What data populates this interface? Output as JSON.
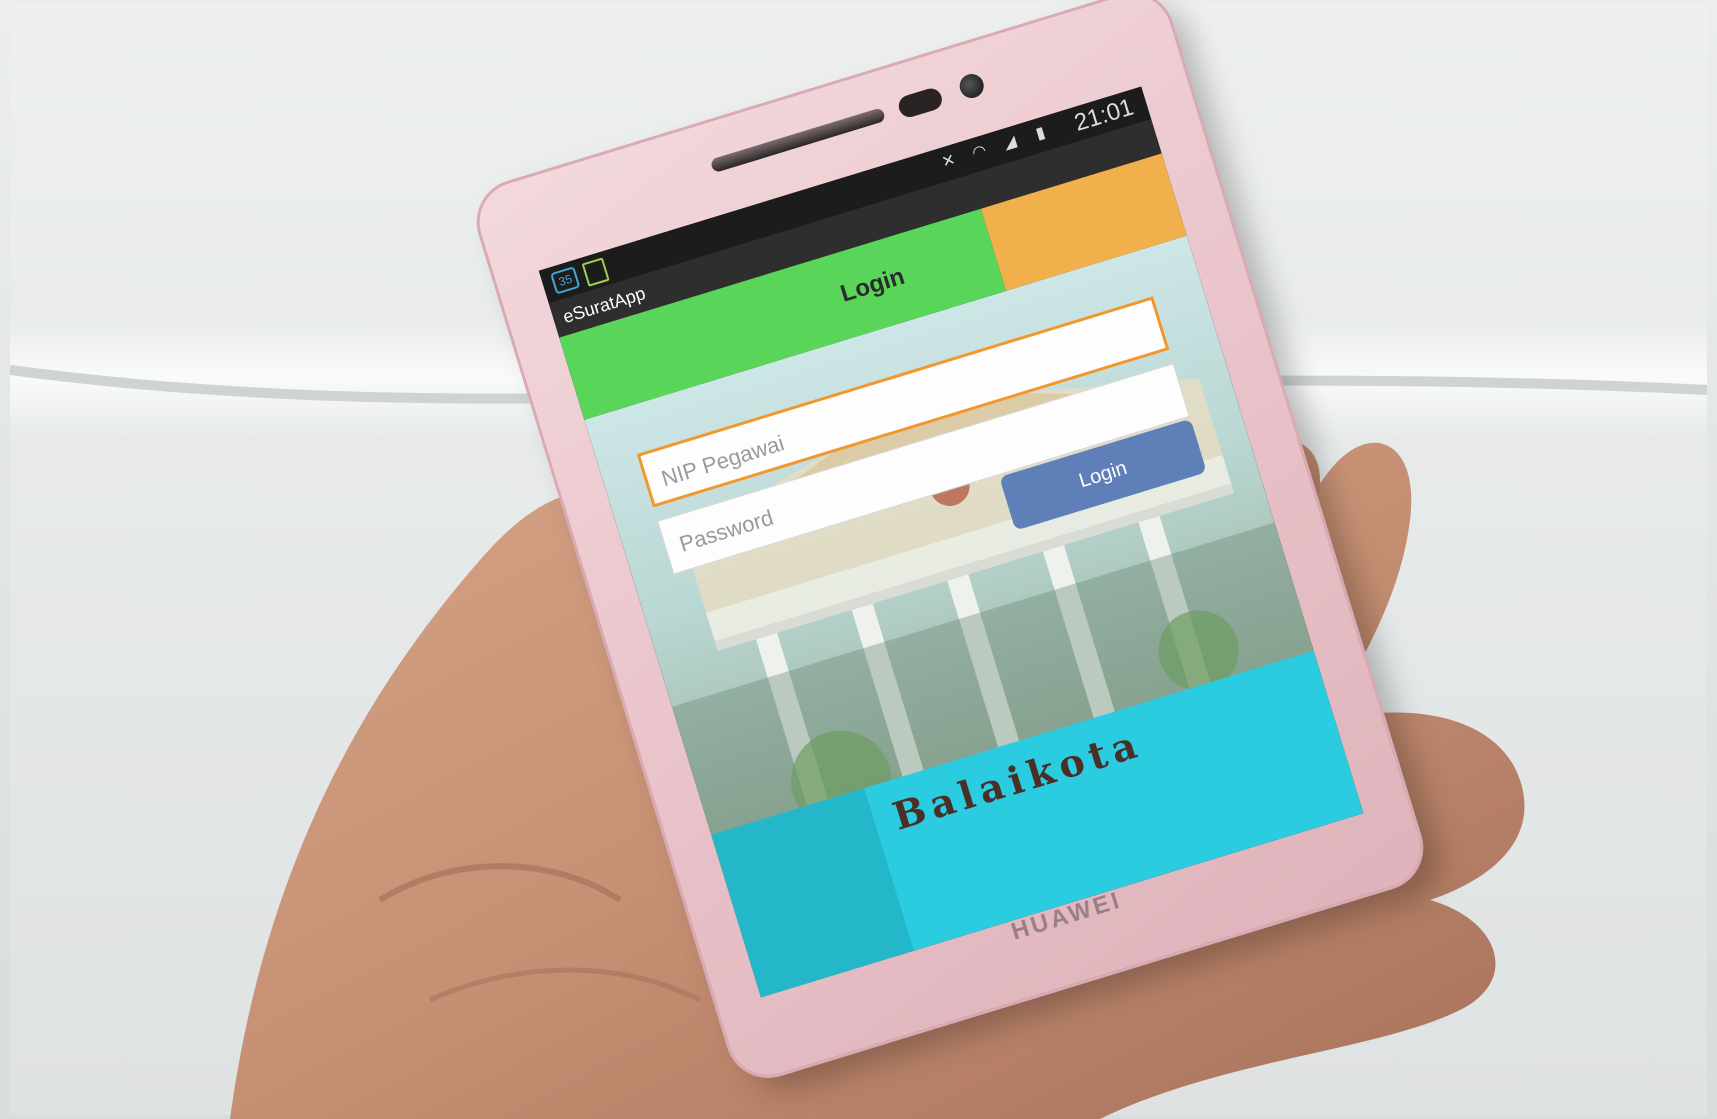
{
  "statusbar": {
    "time": "21:01",
    "badge": "35"
  },
  "app": {
    "title": "eSuratApp",
    "header_title": "Login"
  },
  "form": {
    "nip_placeholder": "NIP Pegawai",
    "password_placeholder": "Password",
    "login_label": "Login"
  },
  "background_sign": "Balaikota",
  "device_brand": "HUAWEI",
  "colors": {
    "header_green": "#59d55a",
    "header_orange": "#f1b04c",
    "input_focus_border": "#f0972e",
    "button_blue": "#5e7fb8",
    "bottom_teal": "#2bcbe0"
  },
  "icons": {
    "status": [
      "mute-icon",
      "wifi-icon",
      "signal-icon",
      "battery-icon"
    ],
    "notification": [
      "badge-icon",
      "app-notification-icon"
    ]
  }
}
